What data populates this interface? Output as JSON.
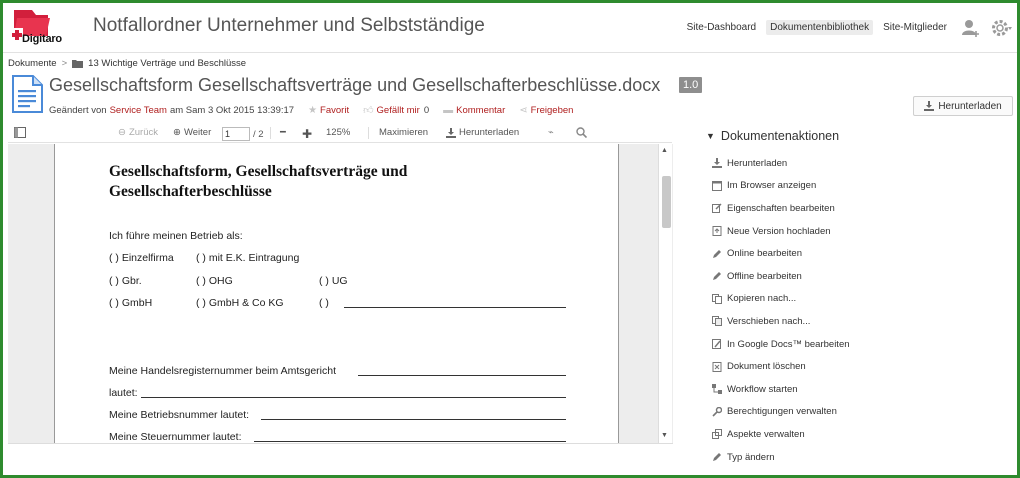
{
  "header": {
    "logo_text": "Digitaro",
    "site_title": "Notfallordner Unternehmer und Selbstständige",
    "nav": [
      "Site-Dashboard",
      "Dokumentenbibliothek",
      "Site-Mitglieder"
    ]
  },
  "breadcrumb": {
    "root": "Dokumente",
    "separator": ">",
    "folder": "13 Wichtige Verträge und Beschlüsse"
  },
  "document": {
    "title": "Gesellschaftsform Gesellschaftsverträge und Gesellschafterbeschlüsse.docx",
    "version": "1.0",
    "modified_prefix": "Geändert von",
    "modified_user": "Service Team",
    "modified_date": "am Sam 3 Okt 2015 13:39:17",
    "favorite": "Favorit",
    "like": "Gefällt mir",
    "like_count": "0",
    "comment": "Kommentar",
    "share": "Freigeben",
    "download_button": "Herunterladen"
  },
  "toolbar": {
    "back": "Zurück",
    "forward": "Weiter",
    "page_value": "1",
    "page_total": "/ 2",
    "zoom": "125%",
    "maximize": "Maximieren",
    "download": "Herunterladen"
  },
  "page_content": {
    "heading": "Gesellschaftsform, Gesellschaftsverträge und Gesellschafterbeschlüsse",
    "intro": "Ich führe meinen Betrieb als:",
    "opt_einzelfirma": "(  ) Einzelfirma",
    "opt_ek": "(  ) mit E.K. Eintragung",
    "opt_gbr": "(  ) Gbr.",
    "opt_ohg": "(  )  OHG",
    "opt_ug": "(  ) UG",
    "opt_gmbh": "(  ) GmbH",
    "opt_gmbh_co": "(  ) GmbH & Co KG",
    "opt_other": "(  )",
    "hr_line1": "Meine Handelsregisternummer beim Amtsgericht",
    "hr_line2": "lautet:",
    "betrieb": "Meine Betriebsnummer lautet:",
    "steuer": "Meine Steuernummer lautet:"
  },
  "panel": {
    "title": "Dokumentenaktionen",
    "actions": [
      {
        "label": "Herunterladen",
        "icon": "download-icon"
      },
      {
        "label": "Im Browser anzeigen",
        "icon": "browser-icon"
      },
      {
        "label": "Eigenschaften bearbeiten",
        "icon": "edit-properties-icon"
      },
      {
        "label": "Neue Version hochladen",
        "icon": "upload-icon"
      },
      {
        "label": "Online bearbeiten",
        "icon": "pencil-icon"
      },
      {
        "label": "Offline bearbeiten",
        "icon": "pencil-icon"
      },
      {
        "label": "Kopieren nach...",
        "icon": "copy-icon"
      },
      {
        "label": "Verschieben nach...",
        "icon": "move-icon"
      },
      {
        "label": "In Google Docs™ bearbeiten",
        "icon": "google-docs-icon"
      },
      {
        "label": "Dokument löschen",
        "icon": "delete-icon"
      },
      {
        "label": "Workflow starten",
        "icon": "workflow-icon"
      },
      {
        "label": "Berechtigungen verwalten",
        "icon": "key-icon"
      },
      {
        "label": "Aspekte verwalten",
        "icon": "aspects-icon"
      },
      {
        "label": "Typ ändern",
        "icon": "pencil-icon"
      }
    ]
  },
  "colors": {
    "border_green": "#2e8b2e",
    "accent_red": "#b02020",
    "logo_red": "#d21f3c"
  }
}
